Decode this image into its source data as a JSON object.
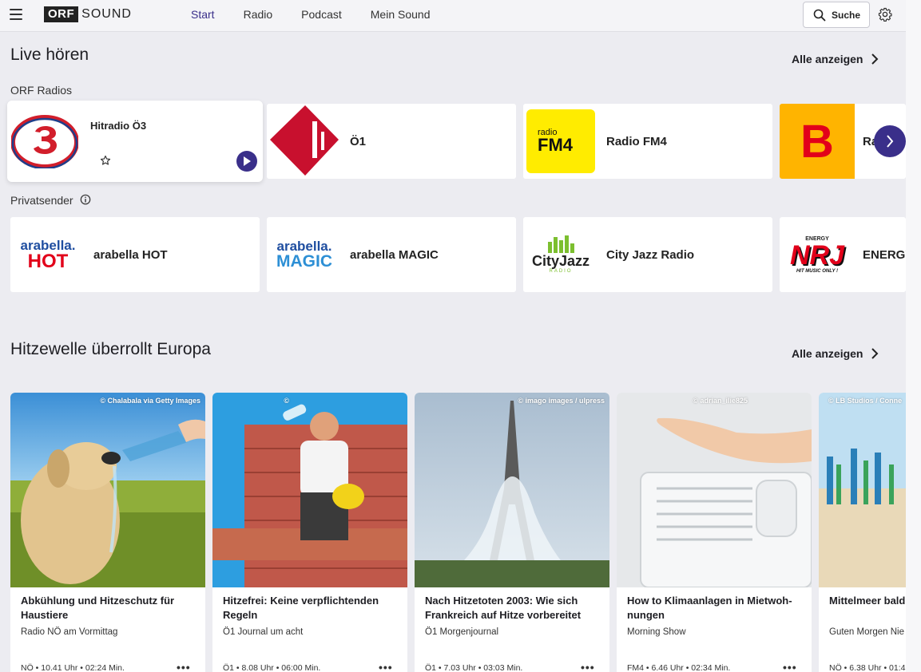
{
  "header": {
    "logo_orf": "ORF",
    "logo_sound": "SOUND",
    "nav": [
      "Start",
      "Radio",
      "Podcast",
      "Mein Sound"
    ],
    "active_nav": "Start",
    "search_label": "Suche"
  },
  "live": {
    "title": "Live hören",
    "more_label": "Alle anzeigen",
    "orf_heading": "ORF Radios",
    "orf_stations": [
      {
        "name": "Hitradio Ö3"
      },
      {
        "name": "Ö1"
      },
      {
        "name": "Radio FM4",
        "logo_top": "radio",
        "logo_main": "FM4"
      },
      {
        "name": "Ra",
        "logo_letter": "B"
      }
    ],
    "private_heading": "Privatsender",
    "private_stations": [
      {
        "name": "arabella HOT",
        "logo_top": "arabella.",
        "logo_main": "HOT"
      },
      {
        "name": "arabella MAGIC",
        "logo_top": "arabella.",
        "logo_main": "MAGIC"
      },
      {
        "name": "City Jazz Radio",
        "logo_main": "CityJazz",
        "logo_sub": "RADIO"
      },
      {
        "name": "ENERGY",
        "logo_main": "NRJ",
        "logo_top": "ENERGY",
        "logo_sub": "HIT MUSIC ONLY !"
      }
    ]
  },
  "heatwave": {
    "title": "Hitzewelle überrollt Europa",
    "more_label": "Alle anzeigen",
    "cards": [
      {
        "credit": "© Chalabala via Getty Images",
        "title": "Abkühlung und Hitzeschutz für Haustiere",
        "show": "Radio NÖ am Vormittag",
        "meta": "NÖ • 10.41 Uhr • 02:24 Min."
      },
      {
        "credit": "©",
        "title": "Hitzefrei: Keine verpflichtenden Regeln",
        "show": "Ö1 Journal um acht",
        "meta": "Ö1 • 8.08 Uhr • 06:00 Min."
      },
      {
        "credit": "© imago images / ulpress",
        "title": "Nach Hitzetoten 2003: Wie sich Frankreich auf Hitze vorbereitet",
        "show": "Ö1 Morgenjournal",
        "meta": "Ö1 • 7.03 Uhr • 03:03 Min."
      },
      {
        "credit": "© adrian_ilie825",
        "title": "How to Klimaanlagen in Mietwoh­nungen",
        "show": "Morning Show",
        "meta": "FM4 • 6.46 Uhr • 02:34 Min."
      },
      {
        "credit": "© LB Studios / Conne",
        "title": "Mittelmeer bald Quallen- und Al",
        "show": "Guten Morgen Nie",
        "meta": "NÖ • 6.38 Uhr • 01:4"
      }
    ]
  }
}
